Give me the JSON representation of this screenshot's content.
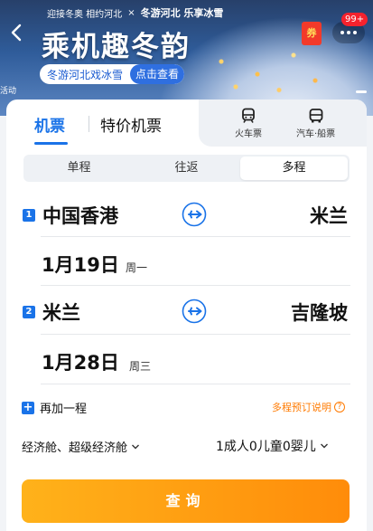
{
  "banner": {
    "promo_small_left": "迎接冬奥 相约河北",
    "promo_small_right": "冬游河北 乐享冰雪",
    "promo_title": "乘机趣冬韵",
    "promo_pill_text": "冬游河北戏冰雪",
    "promo_pill_button": "点击查看",
    "activity_label": "活动",
    "coupon_label": "券",
    "notification_count": "99+"
  },
  "tabs": {
    "flight": "机票",
    "special": "特价机票",
    "train": "火车票",
    "bus": "汽车·船票"
  },
  "trip_type": {
    "options": [
      "单程",
      "往返",
      "多程"
    ],
    "selected": "多程"
  },
  "legs": [
    {
      "num": "1",
      "from": "中国香港",
      "to": "米兰",
      "date": "1月19日",
      "weekday": "周一"
    },
    {
      "num": "2",
      "from": "米兰",
      "to": "吉隆坡",
      "date": "1月28日",
      "weekday": "周三"
    }
  ],
  "add_leg": {
    "plus": "+",
    "label": "再加一程"
  },
  "help_link": {
    "label": "多程预订说明",
    "icon": "?"
  },
  "cabin_class": "经济舱、超级经济舱",
  "passengers": "1成人0儿童0婴儿",
  "search_button": "查询",
  "colors": {
    "accent": "#1a73e8",
    "search": "#ff9a12",
    "help": "#ff7a00"
  }
}
